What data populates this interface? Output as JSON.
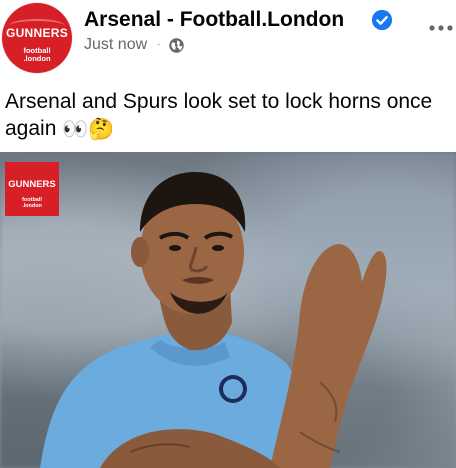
{
  "post": {
    "page_name": "Arsenal - Football.London",
    "timestamp": "Just now",
    "separator": "·",
    "text": "Arsenal and Spurs look set to lock horns once again",
    "emoji_eyes": "👀",
    "emoji_thinking": "🤔"
  },
  "avatar": {
    "brand": "GUNNERS",
    "sub_line1": "football",
    "sub_line2": ".london"
  },
  "photo_logo": {
    "brand": "GUNNERS",
    "sub_line1": "football",
    "sub_line2": ".london"
  },
  "colors": {
    "brand_red": "#d61f26",
    "verified_blue": "#1877f2",
    "meta_gray": "#65676b",
    "sky_blue_kit": "#6cabdd"
  },
  "icons": {
    "verified": "verified-badge-icon",
    "privacy": "globe-icon",
    "menu": "more-options-icon"
  }
}
